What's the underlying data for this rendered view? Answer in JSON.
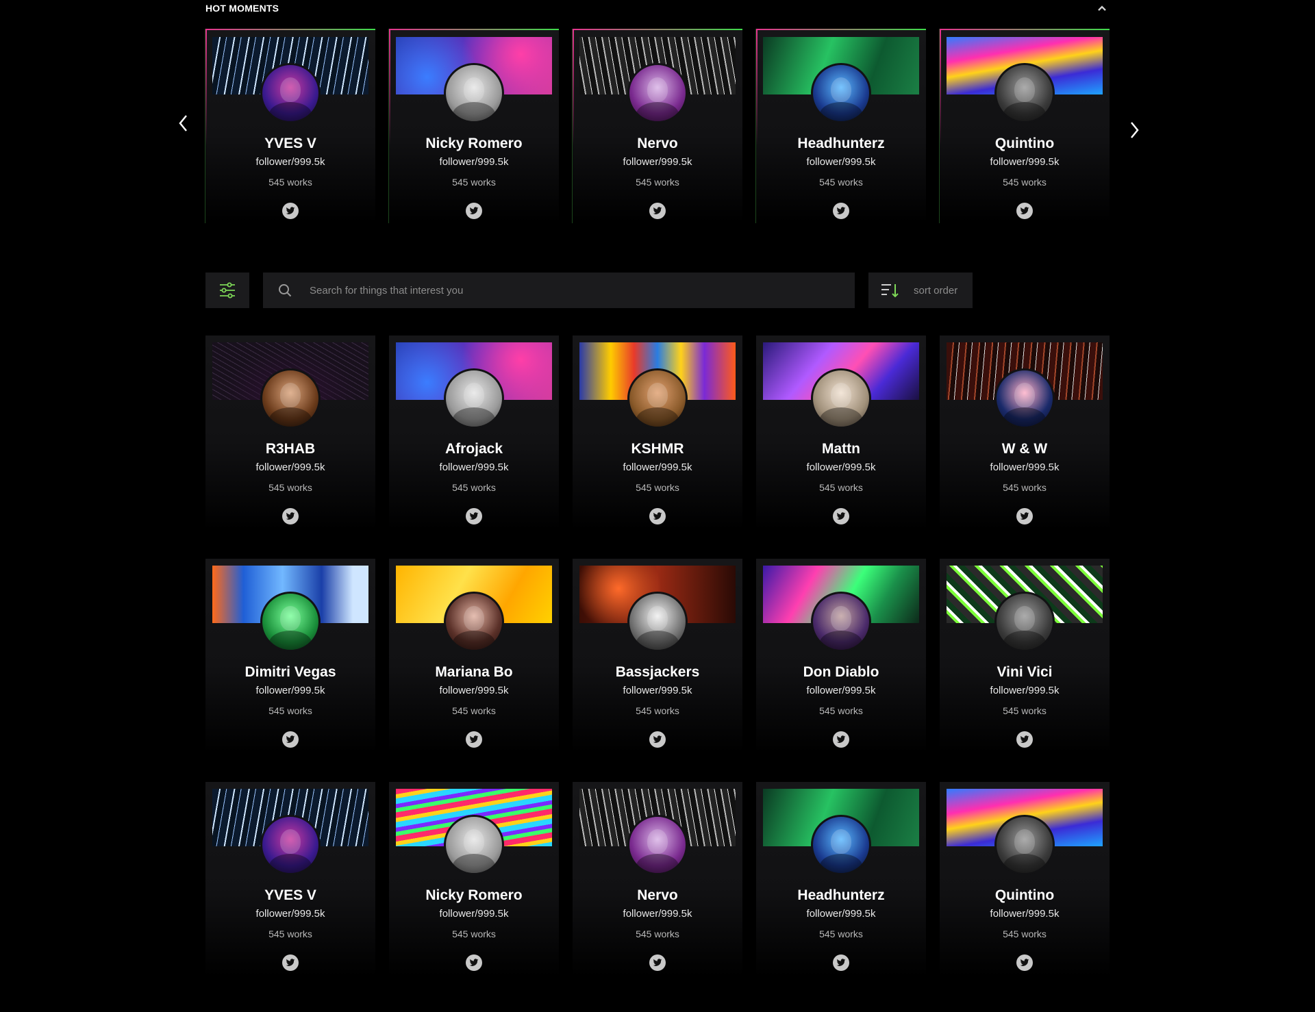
{
  "hot_moments": {
    "title": "HOT MOMENTS",
    "cards": [
      {
        "name": "YVES V",
        "followers": "follower/999.5k",
        "works": "545 works",
        "social": "twitter-icon"
      },
      {
        "name": "Nicky Romero",
        "followers": "follower/999.5k",
        "works": "545 works",
        "social": "twitter-icon"
      },
      {
        "name": "Nervo",
        "followers": "follower/999.5k",
        "works": "545 works",
        "social": "twitter-icon"
      },
      {
        "name": "Headhunterz",
        "followers": "follower/999.5k",
        "works": "545 works",
        "social": "twitter-icon"
      },
      {
        "name": "Quintino",
        "followers": "follower/999.5k",
        "works": "545 works",
        "social": "twitter-icon"
      }
    ]
  },
  "toolbar": {
    "filter_icon": "sliders-icon",
    "search_placeholder": "Search for things that interest you",
    "search_value": "",
    "sort_label": "sort order"
  },
  "artists": [
    {
      "name": "R3HAB",
      "followers": "follower/999.5k",
      "works": "545 works"
    },
    {
      "name": "Afrojack",
      "followers": "follower/999.5k",
      "works": "545 works"
    },
    {
      "name": "KSHMR",
      "followers": "follower/999.5k",
      "works": "545 works"
    },
    {
      "name": "Mattn",
      "followers": "follower/999.5k",
      "works": "545 works"
    },
    {
      "name": "W & W",
      "followers": "follower/999.5k",
      "works": "545 works"
    },
    {
      "name": "Dimitri Vegas",
      "followers": "follower/999.5k",
      "works": "545 works"
    },
    {
      "name": "Mariana Bo",
      "followers": "follower/999.5k",
      "works": "545 works"
    },
    {
      "name": "Bassjackers",
      "followers": "follower/999.5k",
      "works": "545 works"
    },
    {
      "name": "Don Diablo",
      "followers": "follower/999.5k",
      "works": "545 works"
    },
    {
      "name": "Vini Vici",
      "followers": "follower/999.5k",
      "works": "545 works"
    },
    {
      "name": "YVES V",
      "followers": "follower/999.5k",
      "works": "545 works"
    },
    {
      "name": "Nicky Romero",
      "followers": "follower/999.5k",
      "works": "545 works"
    },
    {
      "name": "Nervo",
      "followers": "follower/999.5k",
      "works": "545 works"
    },
    {
      "name": "Headhunterz",
      "followers": "follower/999.5k",
      "works": "545 works"
    },
    {
      "name": "Quintino",
      "followers": "follower/999.5k",
      "works": "545 works"
    }
  ],
  "colors": {
    "background": "#000000",
    "card": "#141416",
    "accent_green": "#7ed957",
    "accent_pink": "#e6338f"
  }
}
